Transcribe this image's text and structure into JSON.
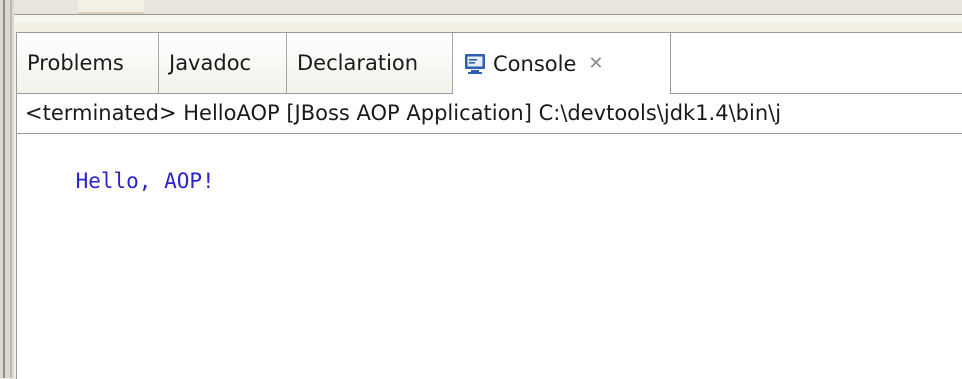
{
  "tabs": [
    {
      "label": "Problems",
      "active": false
    },
    {
      "label": "Javadoc",
      "active": false
    },
    {
      "label": "Declaration",
      "active": false
    },
    {
      "label": "Console",
      "active": true,
      "icon": "console-icon",
      "closable": true
    }
  ],
  "console": {
    "status": "<terminated> HelloAOP [JBoss AOP Application] C:\\devtools\\jdk1.4\\bin\\j",
    "output": "Hello, AOP!"
  },
  "colors": {
    "output_text": "#2d24c8",
    "console_icon": "#2f5fb3"
  }
}
